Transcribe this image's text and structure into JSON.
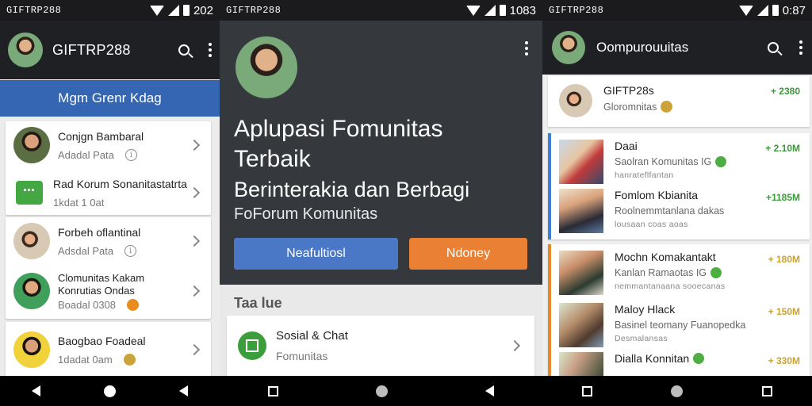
{
  "panel1": {
    "status": {
      "left": "GIFTRP288",
      "time": "202"
    },
    "appbar": {
      "title": "GIFTRP288"
    },
    "banner": "Mgm Grenr Kdag",
    "groups": [
      {
        "items": [
          {
            "title": "Conjgn Bambaral",
            "sub": "Adadal Pata",
            "trail": "info"
          },
          {
            "title": "Rad Korum Sonanitastatrta",
            "sub": "1kdat 1 0at",
            "trail": "none"
          }
        ]
      },
      {
        "items": [
          {
            "title": "Forbeh oflantinal",
            "sub": "Adsdal Pata",
            "trail": "info"
          },
          {
            "title": "Clomunitas Kakam Konrutias Ondas",
            "sub": "Boadal 0308",
            "trail": "badge"
          }
        ]
      },
      {
        "items": [
          {
            "title": "Baogbao Foadeal",
            "sub": "1dadat 0am",
            "trail": "badge"
          }
        ]
      }
    ]
  },
  "panel2": {
    "status": {
      "left": "GIFTRP288",
      "time": "1083"
    },
    "hero": {
      "title": "Aplupasi Fomunitas Terbaik",
      "subtitle": "Berinterakia dan Berbagi",
      "tagline": "FoForum Komunitas",
      "primary_button": "Neafultiosl",
      "secondary_button": "Ndoney"
    },
    "section_label": "Taa lue",
    "card": {
      "title": "Sosial & Chat",
      "subtitle": "Fomunitas"
    }
  },
  "panel3": {
    "status": {
      "left": "GIFTRP288",
      "time": "0:87"
    },
    "appbar": {
      "title": "Oompurouuitas"
    },
    "top_card": {
      "name": "GIFTP28s",
      "sub": "Gloromnitas",
      "price": "+ 2380"
    },
    "items": [
      {
        "name": "Daai",
        "sub": "Saolran Komunitas IG",
        "meta": "hanrateflfantan",
        "price": "+ 2.10M",
        "price_color": "#3a9a3a"
      },
      {
        "name": "Fomlom Kbianita",
        "sub": "Roolnemmtanlana dakas",
        "meta": "lousaan coas aoas",
        "price": "+1185M",
        "price_color": "#3a9a3a"
      },
      {
        "name": "Mochn Komakantakt",
        "sub": "Kanlan Ramaotas IG",
        "meta": "nemmantanaana sooecanas",
        "price": "+ 180M",
        "price_color": "#c9a232"
      },
      {
        "name": "Maloy Hlack",
        "sub": "Basinel teomany Fuanopedka",
        "meta": "Desmalansas",
        "price": "+ 150M",
        "price_color": "#c9a232"
      },
      {
        "name": "Dialla Konnitan",
        "sub": "",
        "meta": "",
        "price": "+ 330M",
        "price_color": "#c9a232"
      }
    ]
  }
}
